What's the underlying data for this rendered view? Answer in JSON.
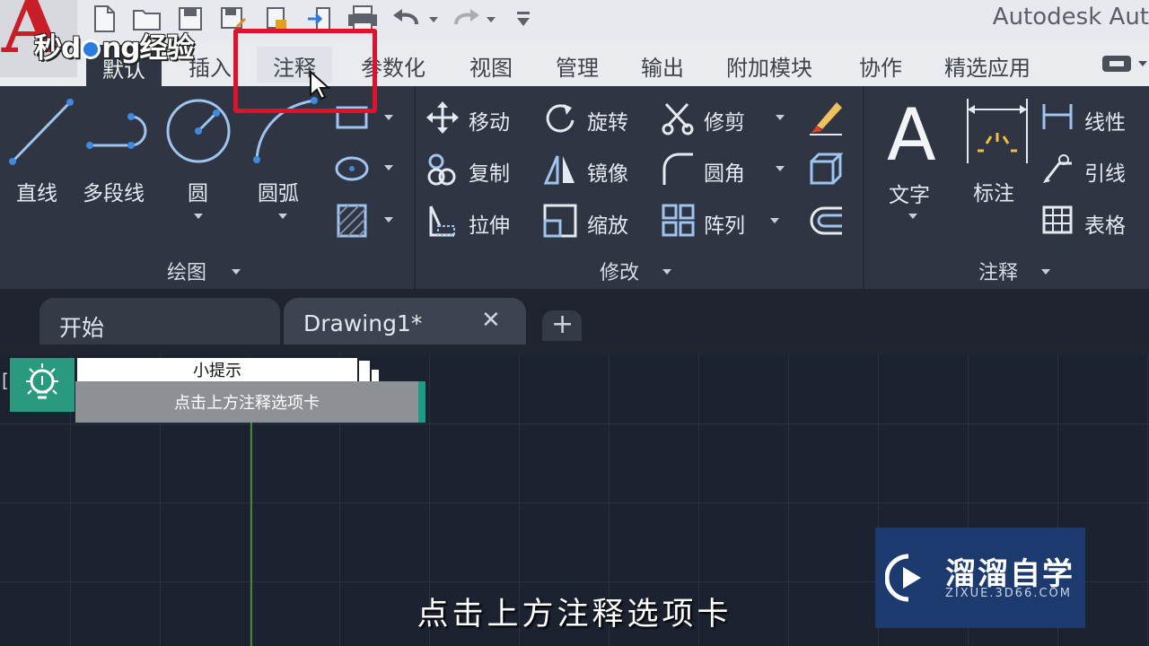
{
  "app": {
    "title": "Autodesk Aut",
    "logo_letter": "A"
  },
  "watermark_top": {
    "text_a": "秒d",
    "text_b": "ng经验"
  },
  "ribbon_tabs": [
    {
      "label": "默认",
      "active": true
    },
    {
      "label": "插入"
    },
    {
      "label": "注释",
      "hovered": true
    },
    {
      "label": "参数化"
    },
    {
      "label": "视图"
    },
    {
      "label": "管理"
    },
    {
      "label": "输出"
    },
    {
      "label": "附加模块"
    },
    {
      "label": "协作"
    },
    {
      "label": "精选应用"
    }
  ],
  "draw_panel": {
    "tools": [
      "直线",
      "多段线",
      "圆",
      "圆弧"
    ],
    "footer": "绘图"
  },
  "modify_panel": {
    "tools": [
      "移动",
      "旋转",
      "修剪",
      "复制",
      "镜像",
      "圆角",
      "拉伸",
      "缩放",
      "阵列"
    ],
    "footer": "修改"
  },
  "annotation_panel": {
    "big_tools": [
      "文字",
      "标注"
    ],
    "small_tools": [
      "线性",
      "引线",
      "表格"
    ],
    "footer": "注释"
  },
  "doc_tabs": [
    {
      "label": "开始"
    },
    {
      "label": "Drawing1*",
      "active": true
    }
  ],
  "doc_tab_close": "✕",
  "doc_tab_add": "+",
  "hint": {
    "title": "小提示",
    "text": "点击上方注释选项卡"
  },
  "subtitle": "点击上方注释选项卡",
  "watermark_br": {
    "title": "溜溜自学",
    "url": "ZIXUE.3D66.COM"
  },
  "colors": {
    "highlight": "#e0112a",
    "ribbon": "#2f3542",
    "accent_blue": "#3f8ae0",
    "hint_green": "#2a9a7e"
  }
}
